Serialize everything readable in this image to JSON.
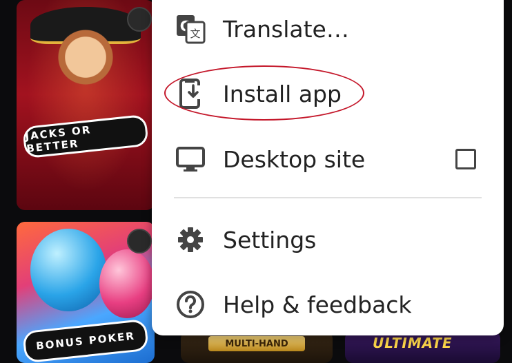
{
  "background_tiles": {
    "jacks_or_better": "JACKS OR BETTER",
    "bonus_poker": "BONUS POKER",
    "multi_hand": "MULTI-HAND",
    "ultimate": "ULTIMATE"
  },
  "menu": {
    "items": [
      {
        "label": "Translate…",
        "icon": "translate-icon"
      },
      {
        "label": "Install app",
        "icon": "install-app-icon"
      },
      {
        "label": "Desktop site",
        "icon": "desktop-icon",
        "checkbox": false
      },
      {
        "label": "Settings",
        "icon": "gear-icon"
      },
      {
        "label": "Help & feedback",
        "icon": "help-icon"
      }
    ]
  },
  "colors": {
    "menu_bg": "#ffffff",
    "text": "#222222",
    "highlight": "#c4172a"
  }
}
